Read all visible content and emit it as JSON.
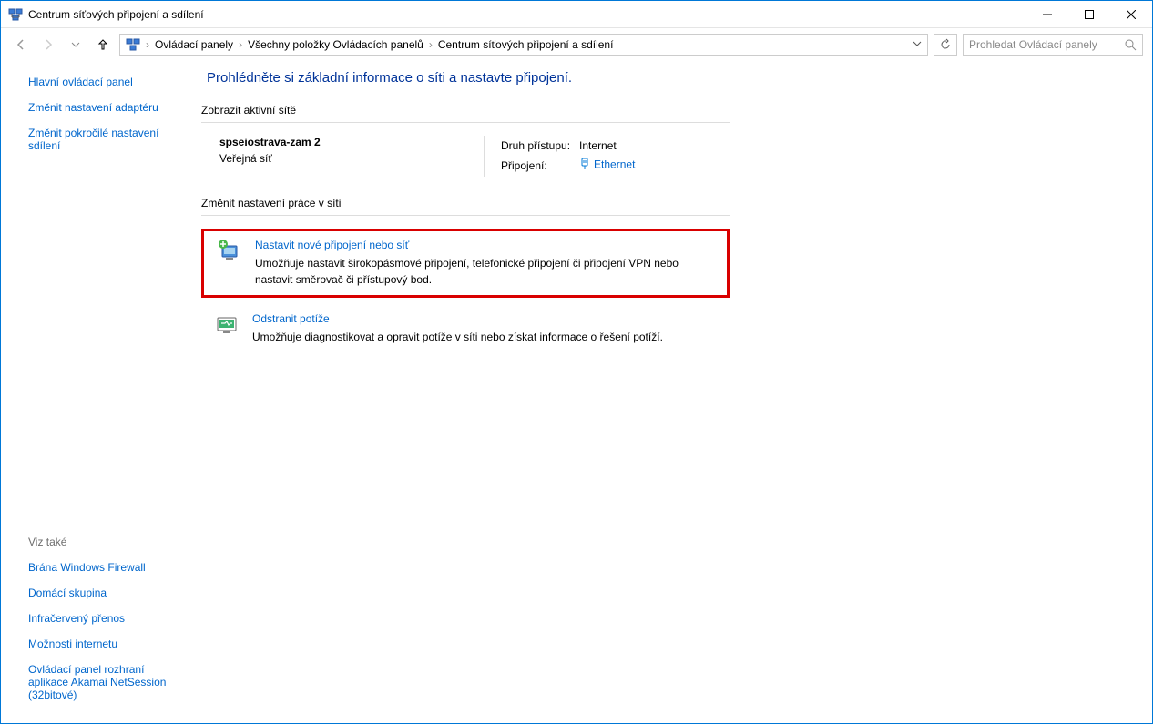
{
  "window": {
    "title": "Centrum síťových připojení a sdílení"
  },
  "breadcrumb": {
    "items": [
      "Ovládací panely",
      "Všechny položky Ovládacích panelů",
      "Centrum síťových připojení a sdílení"
    ]
  },
  "search": {
    "placeholder": "Prohledat Ovládací panely"
  },
  "sidebar": {
    "links": [
      "Hlavní ovládací panel",
      "Změnit nastavení adaptéru",
      "Změnit pokročilé nastavení sdílení"
    ],
    "see_also_title": "Viz také",
    "see_also": [
      "Brána Windows Firewall",
      "Domácí skupina",
      "Infračervený přenos",
      "Možnosti internetu",
      "Ovládací panel rozhraní aplikace Akamai NetSession (32bitové)"
    ]
  },
  "main": {
    "heading": "Prohlédněte si základní informace o síti a nastavte připojení.",
    "active_networks_title": "Zobrazit aktivní sítě",
    "network": {
      "name": "spseiostrava-zam  2",
      "type": "Veřejná síť",
      "access_label": "Druh přístupu:",
      "access_value": "Internet",
      "conn_label": "Připojení:",
      "conn_value": "Ethernet"
    },
    "change_settings_title": "Změnit nastavení práce v síti",
    "tasks": [
      {
        "title": "Nastavit nové připojení nebo síť",
        "desc": "Umožňuje nastavit širokopásmové připojení, telefonické připojení či připojení VPN nebo nastavit směrovač či přístupový bod.",
        "highlight": true
      },
      {
        "title": "Odstranit potíže",
        "desc": "Umožňuje diagnostikovat a opravit potíže v síti nebo získat informace o řešení potíží.",
        "highlight": false
      }
    ]
  }
}
